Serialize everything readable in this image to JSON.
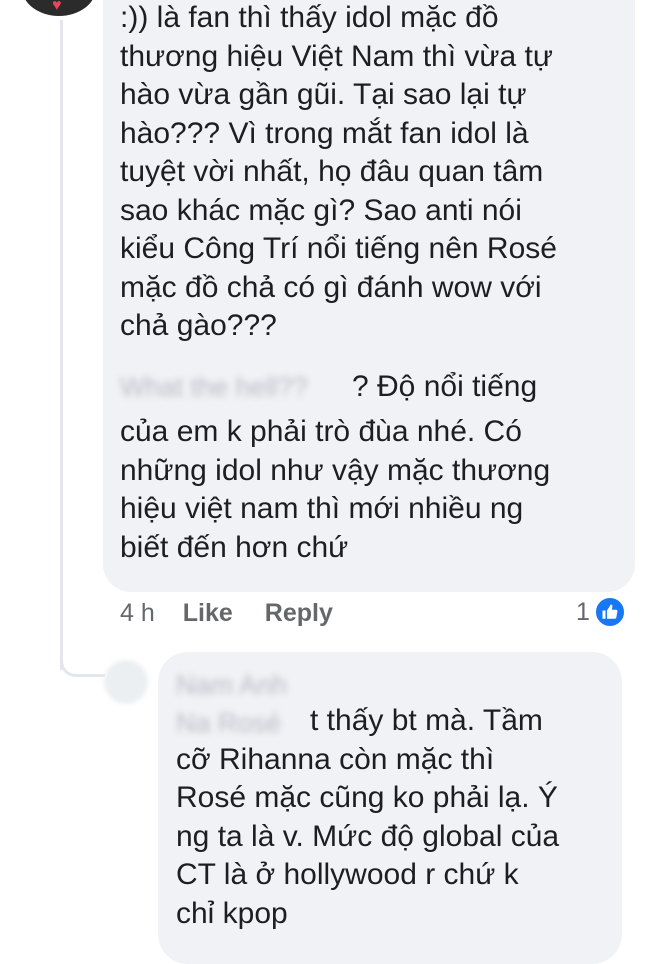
{
  "comment": {
    "lines": [
      ":)) là fan thì thấy idol mặc đồ",
      "thương hiệu Việt Nam thì vừa tự",
      "hào vừa gần gũi. Tại sao lại tự",
      "hào??? Vì trong mắt fan idol là",
      "tuyệt vời nhất, họ đâu quan tâm",
      "sao khác mặc gì? Sao anti nói",
      "kiểu Công Trí nổi tiếng nên Rosé",
      "mặc đồ chả có gì đánh wow với",
      "chả gào???"
    ],
    "blurred_text": "What the hell??",
    "line9_visible": "? Độ nổi tiếng",
    "more_lines": [
      "của em k phải trò đùa nhé. Có",
      "những idol như vậy mặc thương",
      "hiệu việt nam thì mới nhiều ng",
      "biết đến hơn chứ"
    ],
    "time": "4 h",
    "like_label": "Like",
    "reply_label": "Reply",
    "reaction_count": "1",
    "reaction_icon": "thumbs-up-icon",
    "reaction_color": "#1877f2"
  },
  "reply": {
    "blurred_author": "Nam Anh",
    "blurred_mention": "Na Rosé",
    "first_line": "t thấy bt mà. Tầm",
    "lines": [
      "cỡ Rihanna còn mặc thì",
      "Rosé mặc cũng ko phải lạ. Ý",
      "ng ta là v. Mức độ global của",
      "CT là ở hollywood r chứ k",
      "chỉ kpop"
    ]
  },
  "colors": {
    "bubble": "#f0f2f5",
    "text": "#1c1e21",
    "secondary": "#65676b",
    "thread_line": "#e4e6eb"
  }
}
